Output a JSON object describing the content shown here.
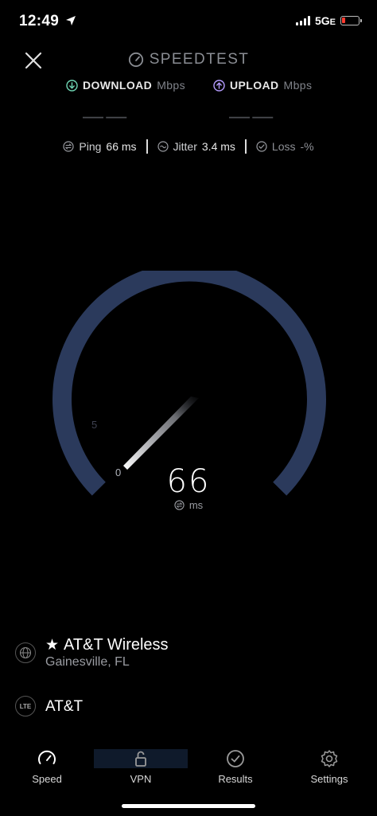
{
  "status_bar": {
    "time": "12:49",
    "network": "5G",
    "network_suffix": "E"
  },
  "header": {
    "title": "SPEEDTEST"
  },
  "download": {
    "label": "DOWNLOAD",
    "unit": "Mbps",
    "value": "— —"
  },
  "upload": {
    "label": "UPLOAD",
    "unit": "Mbps",
    "value": "— —"
  },
  "stats": {
    "ping_label": "Ping",
    "ping_value": "66",
    "ping_unit": "ms",
    "jitter_label": "Jitter",
    "jitter_value": "3.4",
    "jitter_unit": "ms",
    "loss_label": "Loss",
    "loss_value": "-%"
  },
  "gauge": {
    "value": "66",
    "unit": "ms",
    "tick_0": "0",
    "tick_5": "5"
  },
  "provider": {
    "isp": "AT&T Wireless",
    "location": "Gainesville, FL",
    "carrier": "AT&T",
    "carrier_badge": "LTE"
  },
  "tabs": [
    {
      "label": "Speed"
    },
    {
      "label": "VPN"
    },
    {
      "label": "Results"
    },
    {
      "label": "Settings"
    }
  ],
  "colors": {
    "gauge_arc": "#2b3a5c",
    "download_accent": "#6fd6b4",
    "upload_accent": "#b59cff",
    "battery": "#ff3b30"
  }
}
